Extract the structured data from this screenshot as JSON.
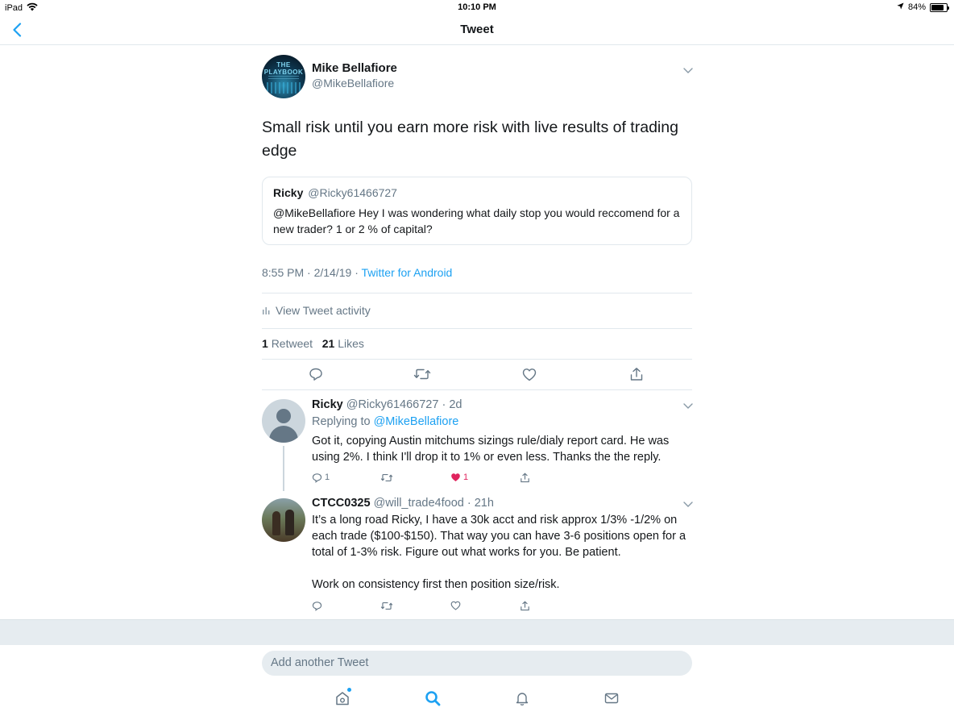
{
  "status_bar": {
    "device": "iPad",
    "time": "10:10 PM",
    "battery": "84%",
    "battery_level": 0.84
  },
  "nav": {
    "title": "Tweet"
  },
  "tweet": {
    "author_name": "Mike Bellafiore",
    "author_handle": "@MikeBellafiore",
    "avatar_text": "THE PLAYBOOK",
    "text": "Small risk until you earn more risk with live results of trading edge",
    "quote": {
      "name": "Ricky",
      "handle": "@Ricky61466727",
      "text": "@MikeBellafiore Hey I was wondering what daily stop you would reccomend for a new trader? 1 or 2 % of capital?"
    },
    "time": "8:55 PM",
    "date": "2/14/19",
    "source": "Twitter for Android",
    "activity_label": "View Tweet activity",
    "retweet_count": "1",
    "retweet_label": "Retweet",
    "like_count": "21",
    "like_label": "Likes"
  },
  "replies": [
    {
      "name": "Ricky",
      "handle": "@Ricky61466727",
      "age": "2d",
      "replying_prefix": "Replying to",
      "replying_to": "@MikeBellafiore",
      "text": "Got it, copying Austin mitchums sizings rule/dialy report card.  He was using 2%.  I think I'll drop it to 1% or even less. Thanks the the reply.",
      "reply_count": "1",
      "like_count": "1"
    },
    {
      "name": "CTCC0325",
      "handle": "@will_trade4food",
      "age": "21h",
      "text": "It’s a long road Ricky, I have a 30k acct and risk approx 1/3% -1/2% on each trade ($100-$150). That way you can have 3-6 positions open for a total of 1-3% risk. Figure out what works for you. Be patient.",
      "text2": "Work on consistency first then position size/risk."
    }
  ],
  "compose": {
    "placeholder": "Add another Tweet"
  },
  "colors": {
    "accent": "#1da1f2",
    "like": "#e0245e",
    "secondary_text": "#657786",
    "border": "#e1e8ed"
  },
  "icons": [
    "wifi-icon",
    "location-arrow-icon",
    "battery-icon",
    "back-chevron-icon",
    "caret-down-icon",
    "bar-chart-icon",
    "reply-icon",
    "retweet-icon",
    "like-icon",
    "share-icon",
    "home-icon",
    "search-icon",
    "bell-icon",
    "mail-icon"
  ]
}
